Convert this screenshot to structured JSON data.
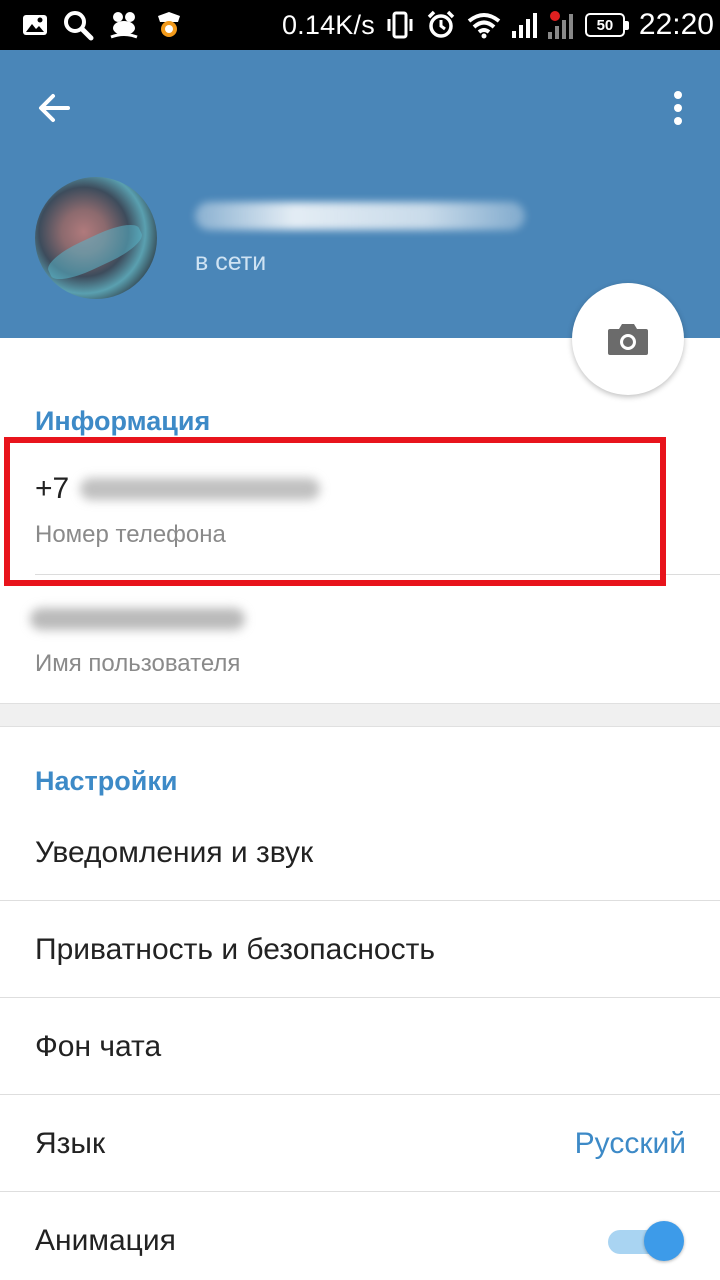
{
  "statusbar": {
    "speed": "0.14K/s",
    "battery": "50",
    "time": "22:20",
    "icons": [
      "image-icon",
      "search-icon",
      "rocking-horse-icon",
      "shield-app-icon",
      "vibrate-icon",
      "alarm-icon",
      "wifi-icon",
      "signal-icon",
      "signal-2-icon",
      "battery-icon"
    ]
  },
  "header": {
    "status": "в сети",
    "back_icon": "arrow-left-icon",
    "menu_icon": "more-vertical-icon",
    "camera_icon": "camera-icon",
    "color": "#4a86b8"
  },
  "info": {
    "title": "Информация",
    "phone_value": "+7",
    "phone_label": "Номер телефона",
    "username_label": "Имя пользователя"
  },
  "settings": {
    "title": "Настройки",
    "items": [
      {
        "label": "Уведомления и звук"
      },
      {
        "label": "Приватность и безопасность"
      },
      {
        "label": "Фон чата"
      },
      {
        "label": "Язык",
        "value": "Русский"
      },
      {
        "label": "Анимация",
        "toggle": true
      }
    ]
  },
  "colors": {
    "accent": "#3d8ac7",
    "highlight": "#e8141c"
  }
}
